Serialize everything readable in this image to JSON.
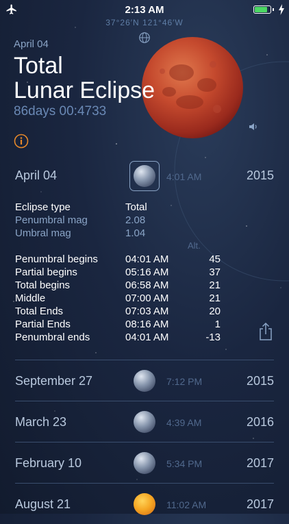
{
  "status": {
    "time": "2:13 AM",
    "coords": "37°26′N 121°46′W"
  },
  "header": {
    "date": "April 04",
    "title_line1": "Total",
    "title_line2": "Lunar Eclipse",
    "countdown": "86days 00:4733"
  },
  "selected": {
    "date": "April 04",
    "time": "4:01 AM",
    "year": "2015"
  },
  "details": {
    "eclipse_type": {
      "label": "Eclipse type",
      "value": "Total"
    },
    "penumbral_mag": {
      "label": "Penumbral mag",
      "value": "2.08"
    },
    "umbral_mag": {
      "label": "Umbral mag",
      "value": "1.04"
    },
    "alt_header": "Alt.",
    "phases": [
      {
        "label": "Penumbral begins",
        "time": "04:01 AM",
        "alt": "45"
      },
      {
        "label": "Partial begins",
        "time": "05:16 AM",
        "alt": "37"
      },
      {
        "label": "Total begins",
        "time": "06:58 AM",
        "alt": "21"
      },
      {
        "label": "Middle",
        "time": "07:00 AM",
        "alt": "21"
      },
      {
        "label": "Total Ends",
        "time": "07:03 AM",
        "alt": "20"
      },
      {
        "label": "Partial Ends",
        "time": "08:16 AM",
        "alt": "1"
      },
      {
        "label": "Penumbral ends",
        "time": "04:01 AM",
        "alt": "-13"
      }
    ]
  },
  "list": [
    {
      "date": "September 27",
      "time": "7:12 PM",
      "year": "2015",
      "type": "lunar"
    },
    {
      "date": "March 23",
      "time": "4:39 AM",
      "year": "2016",
      "type": "lunar"
    },
    {
      "date": "February 10",
      "time": "5:34 PM",
      "year": "2017",
      "type": "lunar"
    },
    {
      "date": "August 21",
      "time": "11:02 AM",
      "year": "2017",
      "type": "solar"
    }
  ],
  "colors": {
    "accent": "#e8892a",
    "moon_red": "#c2452c",
    "text_muted": "#8aa4c6",
    "battery": "#4cd964"
  }
}
